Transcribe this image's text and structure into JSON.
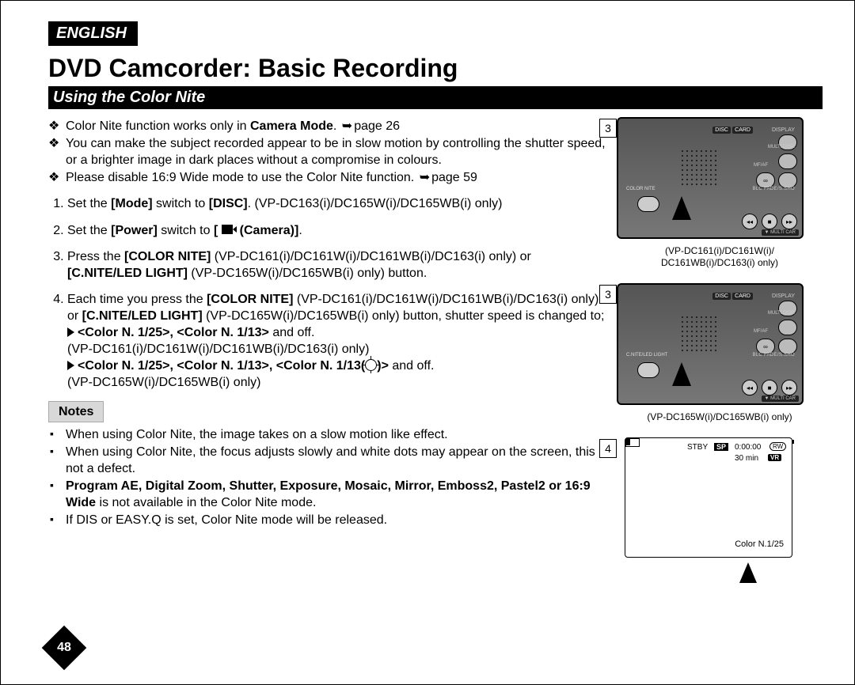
{
  "language_label": "ENGLISH",
  "title": "DVD Camcorder: Basic Recording",
  "section_title": "Using the Color Nite",
  "intro_bullets": [
    {
      "pre": "Color Nite function works only in ",
      "bold": "Camera Mode",
      "post": ". ",
      "page_ref": "page 26"
    },
    {
      "pre": "You can make the subject recorded appear to be in slow motion by controlling the shutter speed, or a brighter image in dark places without a compromise in colours.",
      "bold": "",
      "post": "",
      "page_ref": ""
    },
    {
      "pre": "Please disable 16:9 Wide mode to use the Color Nite function. ",
      "bold": "",
      "post": "",
      "page_ref": "page 59"
    }
  ],
  "steps": {
    "s1_pre": "Set the ",
    "s1_b1": "[Mode]",
    "s1_mid": " switch to ",
    "s1_b2": "[DISC]",
    "s1_post": ". (VP-DC163(i)/DC165W(i)/DC165WB(i) only)",
    "s2_pre": "Set the ",
    "s2_b1": "[Power]",
    "s2_mid": " switch to ",
    "s2_b2": "(Camera)]",
    "s2_post": ".",
    "s3_pre": "Press the ",
    "s3_b1": "[COLOR NITE]",
    "s3_mid": " (VP-DC161(i)/DC161W(i)/DC161WB(i)/DC163(i) only) or ",
    "s3_b2": "[C.NITE/LED LIGHT]",
    "s3_post": " (VP-DC165W(i)/DC165WB(i) only) button.",
    "s4_pre": "Each time you press the ",
    "s4_b1": "[COLOR NITE]",
    "s4_mid1": " (VP-DC161(i)/DC161W(i)/DC161WB(i)/DC163(i) only) or ",
    "s4_b2": "[C.NITE/LED LIGHT]",
    "s4_mid2": " (VP-DC165W(i)/DC165WB(i) only) button, shutter speed is changed to;",
    "s4_line1_b": "<Color N. 1/25>, <Color N. 1/13>",
    "s4_line1_t": " and off.",
    "s4_line1_models": "(VP-DC161(i)/DC161W(i)/DC161WB(i)/DC163(i) only)",
    "s4_line2_b1": "<Color N. 1/25>, <Color N. 1/13>, <Color N. 1/13(",
    "s4_line2_b2": ")>",
    "s4_line2_t": " and off.",
    "s4_line2_models": "(VP-DC165W(i)/DC165WB(i) only)"
  },
  "notes_label": "Notes",
  "notes": [
    {
      "pre": "When using Color Nite, the image takes on a slow motion like effect.",
      "bold": "",
      "post": ""
    },
    {
      "pre": "When using Color Nite, the focus adjusts slowly and white dots may appear on the screen, this is not a defect.",
      "bold": "",
      "post": ""
    },
    {
      "pre": "",
      "bold": "Program AE, Digital Zoom, Shutter, Exposure, Mosaic, Mirror, Emboss2, Pastel2 or 16:9 Wide",
      "post": " is not available in the Color Nite mode."
    },
    {
      "pre": "If DIS or EASY.Q is set, Color Nite mode will be released.",
      "bold": "",
      "post": ""
    }
  ],
  "page_number": "48",
  "figures": {
    "badge_3": "3",
    "badge_4": "4",
    "caption_1_line1": "(VP-DC161(i)/DC161W(i)/",
    "caption_1_line2": "DC161WB(i)/DC163(i) only)",
    "caption_2": "(VP-DC165W(i)/DC165WB(i) only)",
    "device_labels": {
      "disc": "DISC",
      "card": "CARD",
      "display": "DISPLAY",
      "multi_disp": "MULTI DISP.",
      "mf_af": "MF/AF",
      "blc_fade": "BLC   FADE/S.SHO",
      "color_nite": "COLOR NITE",
      "cnite_led": "C.NITE/LED LIGHT",
      "multi_card": "▼ MULTI CAR"
    },
    "osd": {
      "stby": "STBY",
      "sp": "SP",
      "time": "0:00:00",
      "rw": "RW",
      "remaining": "30 min",
      "vr": "VR",
      "color_nite_value": "Color N.1/25"
    }
  }
}
